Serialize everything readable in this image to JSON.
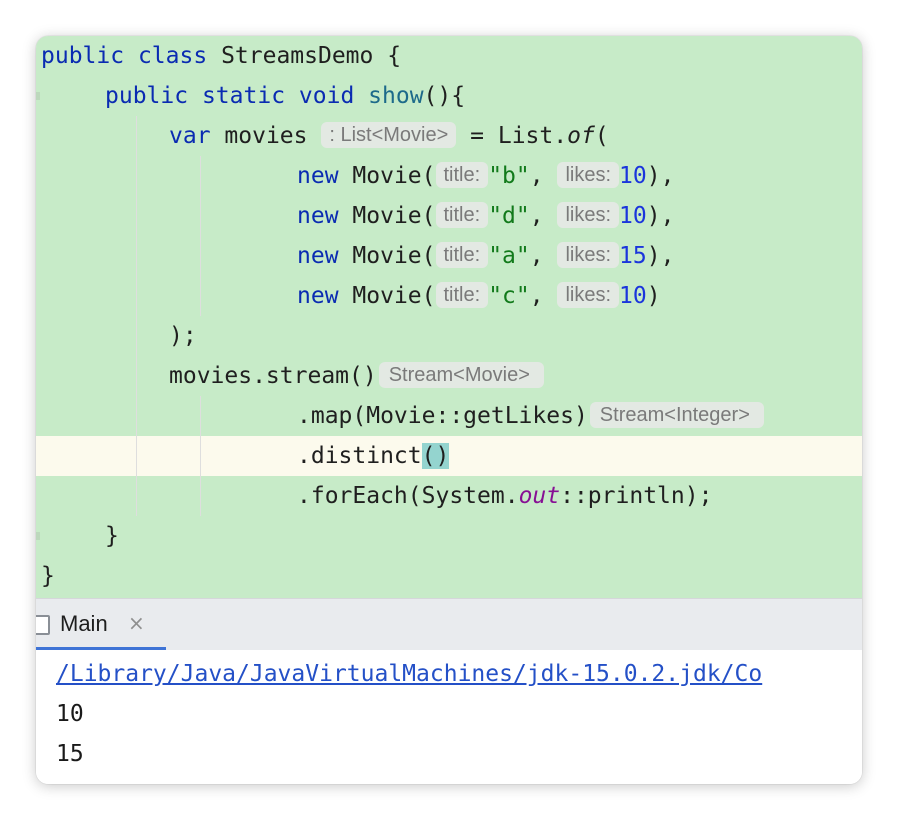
{
  "editor": {
    "line1": {
      "kw1": "public",
      "kw2": "class",
      "name": "StreamsDemo",
      "brace": "{"
    },
    "line2": {
      "kw1": "public",
      "kw2": "static",
      "kw3": "void",
      "method": "show",
      "rest": "(){"
    },
    "line3": {
      "kw": "var",
      "name": "movies",
      "hint": ": List<Movie>",
      "eq": "= List.",
      "of": "of",
      "paren": "("
    },
    "movies": [
      {
        "kw": "new",
        "cls": "Movie(",
        "title_hint": "title:",
        "title": "\"b\"",
        "comma": ",",
        "likes_hint": "likes:",
        "likes": "10",
        "end": "),"
      },
      {
        "kw": "new",
        "cls": "Movie(",
        "title_hint": "title:",
        "title": "\"d\"",
        "comma": ",",
        "likes_hint": "likes:",
        "likes": "10",
        "end": "),"
      },
      {
        "kw": "new",
        "cls": "Movie(",
        "title_hint": "title:",
        "title": "\"a\"",
        "comma": ",",
        "likes_hint": "likes:",
        "likes": "15",
        "end": "),"
      },
      {
        "kw": "new",
        "cls": "Movie(",
        "title_hint": "title:",
        "title": "\"c\"",
        "comma": ",",
        "likes_hint": "likes:",
        "likes": "10",
        "end": ")"
      }
    ],
    "close_list": ");",
    "stream_line": {
      "code": "movies.stream()",
      "hint": "Stream<Movie>"
    },
    "map_line": {
      "code": ".map(Movie::getLikes)",
      "hint": "Stream<Integer>"
    },
    "distinct_line": {
      "code": ".distinct",
      "parens": "()"
    },
    "foreach_line": {
      "pre": ".forEach(System.",
      "field": "out",
      "post": "::println);"
    },
    "close_method": "}",
    "close_class": "}"
  },
  "run_panel": {
    "tab_label": "Main",
    "tab_close": "×",
    "output": {
      "path": "/Library/Java/JavaVirtualMachines/jdk-15.0.2.jdk/Co",
      "lines": [
        "10",
        "15"
      ]
    }
  },
  "colors": {
    "editor_bg": "#c7ebc8",
    "current_line_bg": "#fcfaed",
    "keyword": "#0a2bb2",
    "string": "#127a1b",
    "number": "#1a35dc",
    "link": "#2450c7",
    "tab_accent": "#3f74d6"
  }
}
